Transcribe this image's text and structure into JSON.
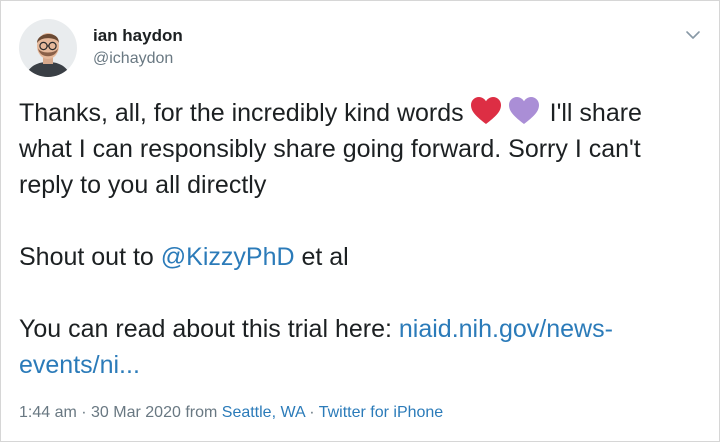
{
  "author": {
    "name": "ian haydon",
    "handle": "@ichaydon"
  },
  "tweet": {
    "line1_text": "Thanks, all, for the incredibly kind words",
    "line1_tail": "I'll share",
    "line2": "what I can responsibly share going forward. Sorry I can't",
    "line3": "reply to you all directly",
    "shout_prefix": "Shout out to ",
    "mention": "@KizzyPhD",
    "shout_suffix": " et al",
    "read_prefix": "You can read about this trial here: ",
    "url_part1": "niaid.nih.gov/news-",
    "url_part2": "events/ni..."
  },
  "meta": {
    "time": "1:44 am",
    "sep1": " · ",
    "date": "30 Mar 2020",
    "from": " from ",
    "location": "Seattle, WA",
    "sep2": " · ",
    "source": "Twitter for iPhone"
  },
  "icons": {
    "avatar": "user-avatar",
    "caret": "chevron-down-icon",
    "heart1": "red-heart-emoji",
    "heart2": "purple-heart-emoji"
  },
  "colors": {
    "text": "#1c2022",
    "muted": "#697882",
    "link": "#2b7bb9",
    "red_heart": "#dd2e44",
    "purple_heart": "#aa8ed6"
  }
}
